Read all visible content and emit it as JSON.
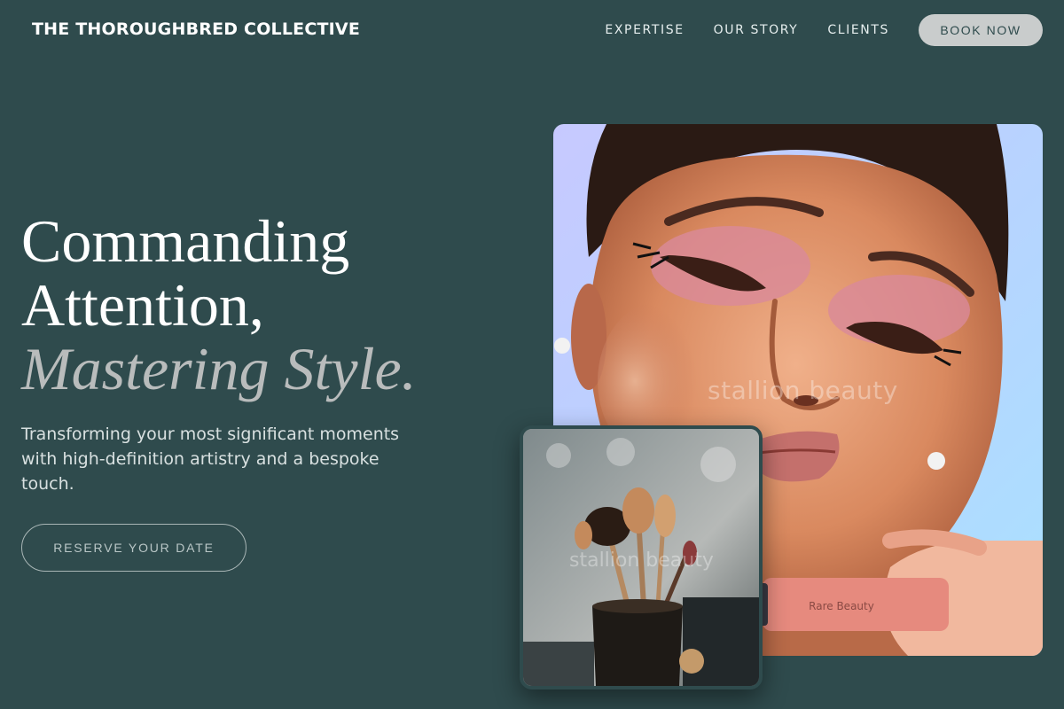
{
  "header": {
    "brand": "THE THOROUGHBRED COLLECTIVE",
    "nav": [
      {
        "label": "EXPERTISE"
      },
      {
        "label": "OUR STORY"
      },
      {
        "label": "CLIENTS"
      }
    ],
    "cta_label": "BOOK NOW"
  },
  "hero": {
    "headline_line1": "Commanding",
    "headline_line2": "Attention,",
    "headline_accent": "Mastering Style.",
    "subtitle": "Transforming your most significant moments with high-definition artistry and a bespoke touch.",
    "cta_label": "RESERVE YOUR DATE"
  },
  "images": {
    "portrait_watermark": "stallion beauty",
    "brushes_watermark": "stallion beauty",
    "product_label": "Rare Beauty"
  },
  "colors": {
    "background": "#2f4b4d",
    "accent_text": "#b9bcbc",
    "button_fill": "#c9cccc"
  }
}
